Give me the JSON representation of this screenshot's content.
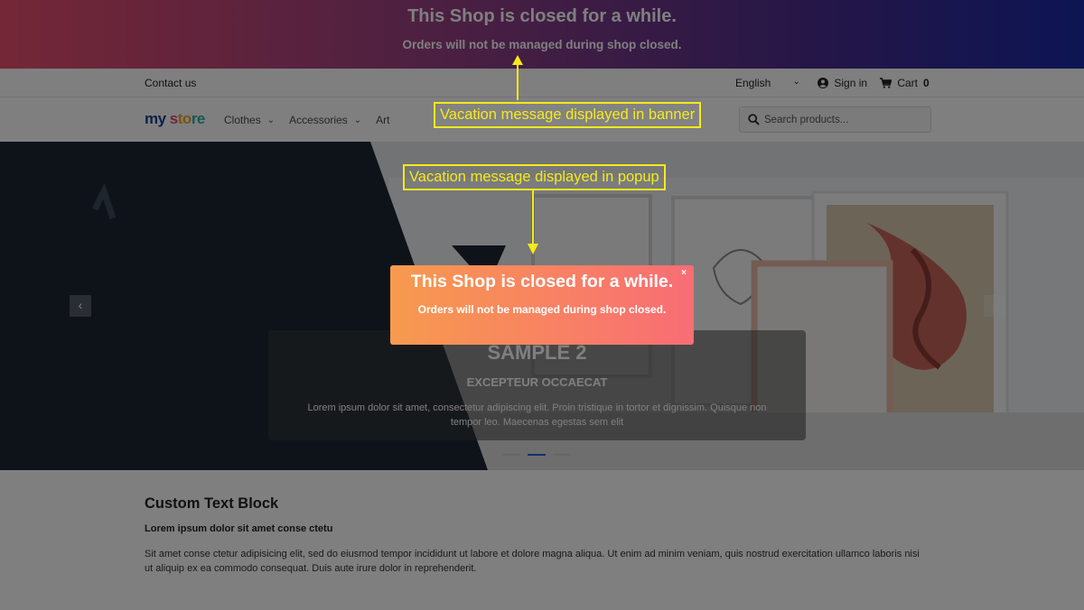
{
  "banner": {
    "title": "This Shop is closed for a while.",
    "subtitle": "Orders will not be managed during shop closed."
  },
  "header": {
    "contact_label": "Contact us",
    "language": "English",
    "signin_label": "Sign in",
    "cart_label": "Cart",
    "cart_count": "0"
  },
  "nav": {
    "logo_parts": [
      "my",
      " s",
      "to",
      "re"
    ],
    "menu": [
      {
        "label": "Clothes",
        "has_dropdown": true
      },
      {
        "label": "Accessories",
        "has_dropdown": true
      },
      {
        "label": "Art",
        "has_dropdown": false
      }
    ],
    "search_placeholder": "Search products..."
  },
  "hero": {
    "caption_title": "SAMPLE 2",
    "caption_subtitle": "EXCEPTEUR OCCAECAT",
    "caption_text": "Lorem ipsum dolor sit amet, consectetur adipiscing elit. Proin tristique in tortor et dignissim. Quisque non tempor leo. Maecenas egestas sem elit",
    "prev_arrow": "‹",
    "next_arrow": "›",
    "slides_count": 3,
    "active_slide": 2
  },
  "content": {
    "title": "Custom Text Block",
    "subtitle": "Lorem ipsum dolor sit amet conse ctetu",
    "text": "Sit amet conse ctetur adipisicing elit, sed do eiusmod tempor incididunt ut labore et dolore magna aliqua. Ut enim ad minim veniam, quis nostrud exercitation ullamco laboris nisi ut aliquip ex ea commodo consequat. Duis aute irure dolor in reprehenderit."
  },
  "popup": {
    "title": "This Shop is closed for a while.",
    "text": "Orders will not be managed during shop closed.",
    "close": "×"
  },
  "annotations": {
    "banner_label": "Vacation message displayed in banner",
    "popup_label": "Vacation message displayed in popup",
    "color": "#f5ea1a"
  },
  "colors": {
    "banner_gradient": [
      "#e94f6e",
      "#4a2d8f",
      "#1a2aa8"
    ],
    "popup_gradient": [
      "#f79a4e",
      "#f86d75"
    ],
    "active_dot": "#2a64d6"
  }
}
